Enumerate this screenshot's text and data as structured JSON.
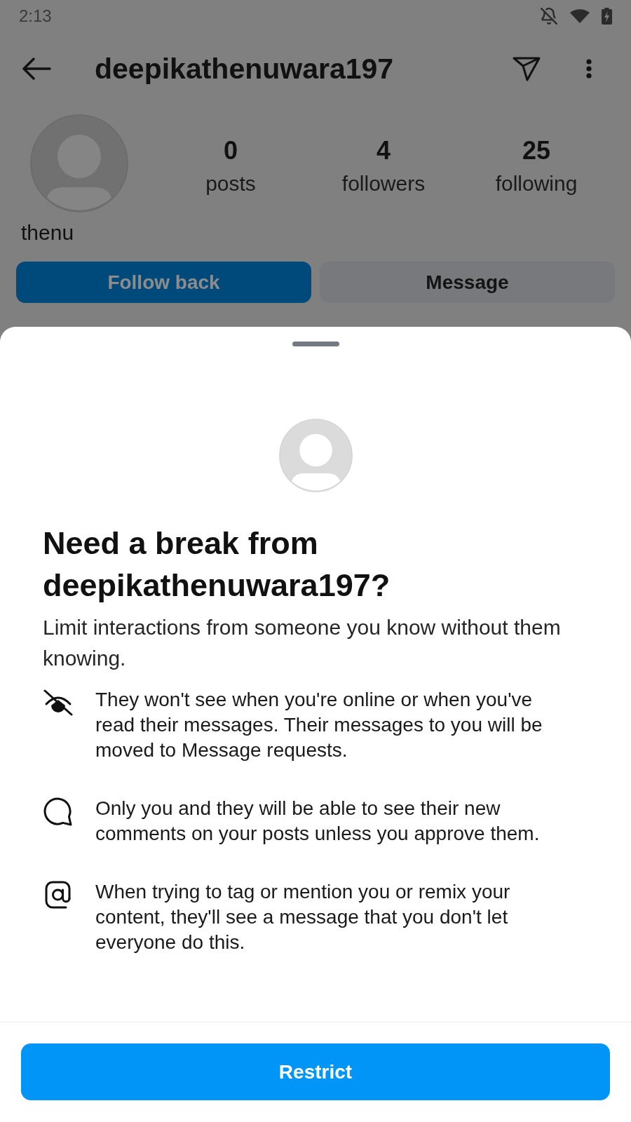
{
  "status_bar": {
    "time": "2:13"
  },
  "header": {
    "title": "deepikathenuwara197"
  },
  "profile": {
    "name": "thenu",
    "stats": [
      {
        "count": "0",
        "label": "posts"
      },
      {
        "count": "4",
        "label": "followers"
      },
      {
        "count": "25",
        "label": "following"
      }
    ]
  },
  "actions": [
    {
      "kind": "primary",
      "label": "Follow back"
    },
    {
      "kind": "secondary",
      "label": "Message"
    }
  ],
  "sheet": {
    "title": "Need a break from deepikathenuwara197?",
    "description": "Limit interactions from someone you know without them knowing.",
    "points": [
      {
        "kind": "activity",
        "text": "They won't see when you're online or when you've read their messages. Their messages to you will be moved to Message requests."
      },
      {
        "kind": "comments",
        "text": "Only you and they will be able to see their new comments on your posts unless you approve them."
      },
      {
        "kind": "mentions",
        "text": "When trying to tag or mention you or remix your content, they'll see a message that you don't let everyone do this."
      }
    ],
    "button": "Restrict"
  }
}
